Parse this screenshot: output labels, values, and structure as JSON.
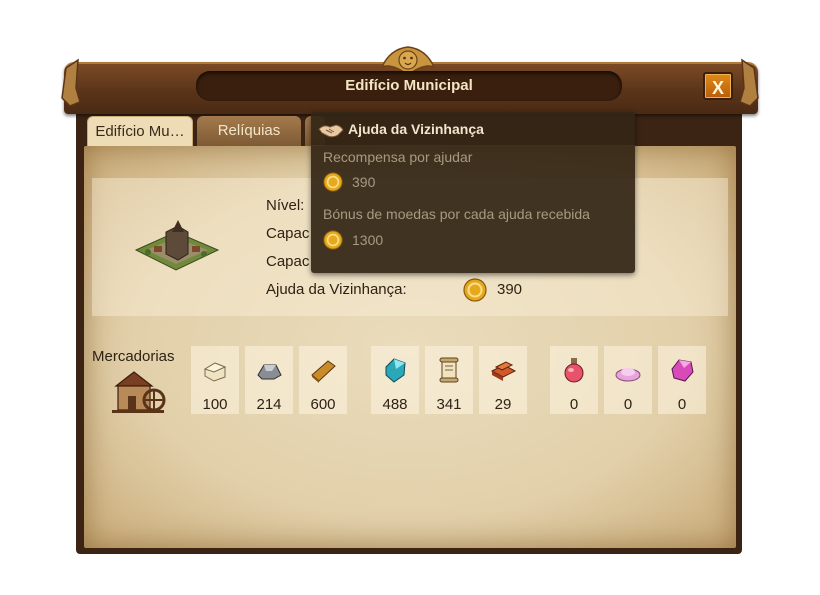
{
  "window": {
    "title": "Edifício Municipal",
    "close_label": "X"
  },
  "tabs": [
    {
      "label": "Edifício Mu…",
      "active": true
    },
    {
      "label": "Relíquias",
      "active": false
    }
  ],
  "building_info": {
    "level_label": "Nível:",
    "capacity1_label": "Capac",
    "capacity2_label": "Capac",
    "aid_label": "Ajuda da Vizinhança:",
    "aid_value": "390"
  },
  "goods": {
    "label": "Mercadorias",
    "items": [
      {
        "icon": "marble-icon",
        "count": "100"
      },
      {
        "icon": "iron-icon",
        "count": "214"
      },
      {
        "icon": "lumber-icon",
        "count": "600"
      },
      {
        "icon": "gem-icon",
        "count": "488"
      },
      {
        "icon": "scroll-icon",
        "count": "341"
      },
      {
        "icon": "brick-icon",
        "count": "29"
      },
      {
        "icon": "elixir-icon",
        "count": "0"
      },
      {
        "icon": "magic-dust-icon",
        "count": "0"
      },
      {
        "icon": "crystal-icon",
        "count": "0"
      }
    ]
  },
  "tooltip": {
    "title": "Ajuda da Vizinhança",
    "reward_label": "Recompensa por ajudar",
    "reward_value": "390",
    "bonus_label": "Bónus de moedas por cada ajuda recebida",
    "bonus_value": "1300"
  },
  "colors": {
    "frame": "#3b2414",
    "parchment": "#e2d0aa",
    "close_button": "#d07514",
    "coin": "#e6a91e"
  }
}
